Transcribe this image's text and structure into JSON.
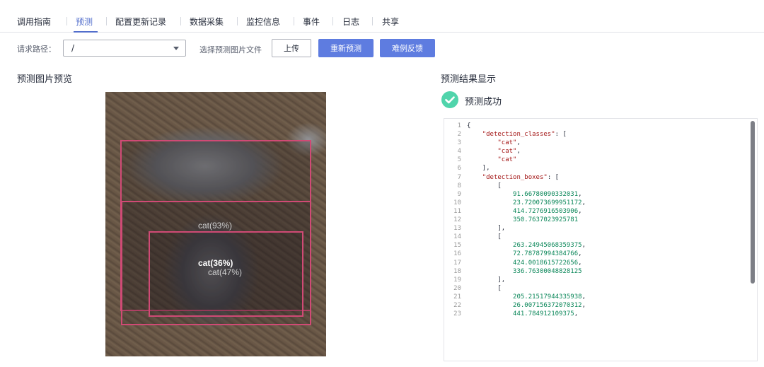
{
  "tabs": [
    "调用指南",
    "预测",
    "配置更新记录",
    "数据采集",
    "监控信息",
    "事件",
    "日志",
    "共享"
  ],
  "active_tab": "预测",
  "toolbar": {
    "path_label": "请求路径：",
    "path_value": "/",
    "file_label": "选择预测图片文件",
    "upload_label": "上传",
    "repredict_label": "重新预测",
    "feedback_label": "难例反馈"
  },
  "preview": {
    "title": "预测图片预览",
    "labels": [
      "cat(93%)",
      "cat(36%)",
      "cat(47%)"
    ]
  },
  "result": {
    "title": "预测结果显示",
    "status": "预测成功",
    "lines": [
      "{",
      "    \"detection_classes\": [",
      "        \"cat\",",
      "        \"cat\",",
      "        \"cat\"",
      "    ],",
      "    \"detection_boxes\": [",
      "        [",
      "            91.66780090332031,",
      "            23.720073699951172,",
      "            414.7276916503906,",
      "            350.7637023925781",
      "        ],",
      "        [",
      "            263.24945068359375,",
      "            72.78787994384766,",
      "            424.0018615722656,",
      "            336.76300048828125",
      "        ],",
      "        [",
      "            205.21517944335938,",
      "            26.007156372070312,",
      "            441.784912109375,"
    ]
  },
  "colors": {
    "accent": "#526ecc",
    "primary_button": "#5e7ce0",
    "success": "#50d4ab",
    "bbox": "#d04a75"
  }
}
